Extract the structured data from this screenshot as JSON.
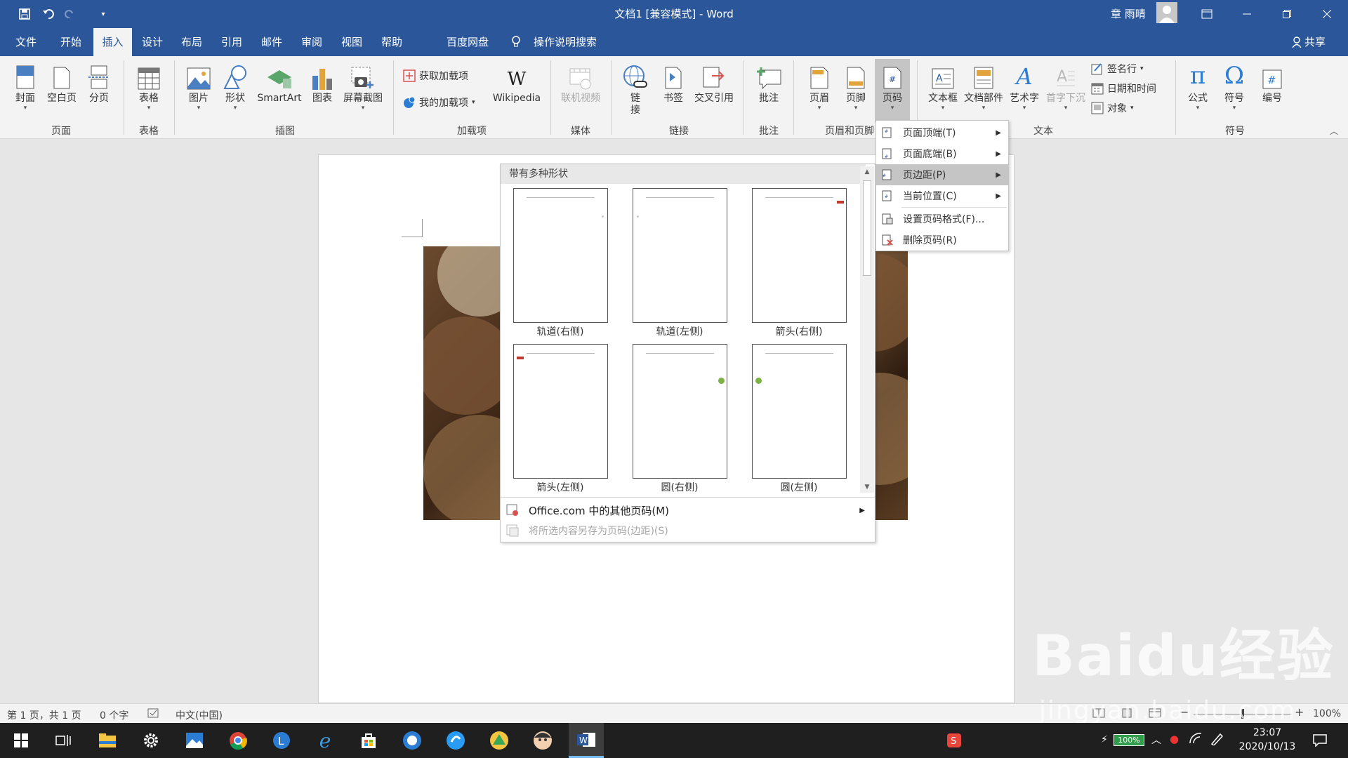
{
  "titlebar": {
    "title": "文档1 [兼容模式] - Word",
    "user": "章 雨晴",
    "icons": [
      "save-icon",
      "undo-icon",
      "redo-icon",
      "customize-qat-icon",
      "ribbon-display-icon",
      "minimize-icon",
      "restore-icon",
      "close-icon"
    ]
  },
  "tabs": {
    "file": "文件",
    "home": "开始",
    "insert": "插入",
    "design": "设计",
    "layout": "布局",
    "references": "引用",
    "mailings": "邮件",
    "review": "审阅",
    "view": "视图",
    "help": "帮助",
    "baidu": "百度网盘",
    "search": "操作说明搜索",
    "share": "共享"
  },
  "ribbon": {
    "pages": {
      "cover": "封面",
      "blank": "空白页",
      "break": "分页",
      "group": "页面"
    },
    "tables": {
      "table": "表格",
      "group": "表格"
    },
    "illustrations": {
      "picture": "图片",
      "shapes": "形状",
      "smartart": "SmartArt",
      "chart": "图表",
      "screenshot": "屏幕截图",
      "group": "插图"
    },
    "addins": {
      "get": "获取加载项",
      "my": "我的加载项",
      "wikipedia": "Wikipedia",
      "group": "加载项"
    },
    "media": {
      "video": "联机视频",
      "group": "媒体"
    },
    "links": {
      "link1": "链",
      "link2": "接",
      "bookmark": "书签",
      "crossref": "交叉引用",
      "group": "链接"
    },
    "comments": {
      "comment": "批注",
      "group": "批注"
    },
    "headerfooter": {
      "header": "页眉",
      "footer": "页脚",
      "pagenum": "页码",
      "group": "页眉和页脚"
    },
    "text": {
      "textbox": "文本框",
      "quickparts": "文档部件",
      "wordart": "艺术字",
      "dropcap": "首字下沉",
      "signature": "签名行",
      "datetime": "日期和时间",
      "object": "对象",
      "group": "文本"
    },
    "symbols": {
      "equation": "公式",
      "symbol": "符号",
      "number": "编号",
      "group": "符号"
    }
  },
  "gallery": {
    "header": "带有多种形状",
    "items": [
      {
        "label": "轨道(右侧)"
      },
      {
        "label": "轨道(左侧)"
      },
      {
        "label": "箭头(右侧)"
      },
      {
        "label": "箭头(左侧)"
      },
      {
        "label": "圆(右侧)"
      },
      {
        "label": "圆(左侧)"
      }
    ],
    "more": "Office.com 中的其他页码(M)",
    "save": "将所选内容另存为页码(边距)(S)"
  },
  "menu": {
    "items": [
      {
        "label": "页面顶端(T)",
        "submenu": true
      },
      {
        "label": "页面底端(B)",
        "submenu": true
      },
      {
        "label": "页边距(P)",
        "submenu": true
      },
      {
        "label": "当前位置(C)",
        "submenu": true
      },
      {
        "label": "设置页码格式(F)...",
        "submenu": false
      },
      {
        "label": "删除页码(R)",
        "submenu": false
      }
    ]
  },
  "status": {
    "page": "第 1 页，共 1 页",
    "words": "0 个字",
    "lang": "中文(中国)",
    "zoom": "100%"
  },
  "taskbar": {
    "battery": "100%",
    "time": "23:07",
    "date": "2020/10/13"
  },
  "watermark": {
    "brand": "Baidu经验",
    "url": "jingyan.baidu.com"
  },
  "colors": {
    "word_blue": "#2b579a",
    "ribbon_bg": "#f3f3f3",
    "taskbar_bg": "#1f1f1f"
  }
}
